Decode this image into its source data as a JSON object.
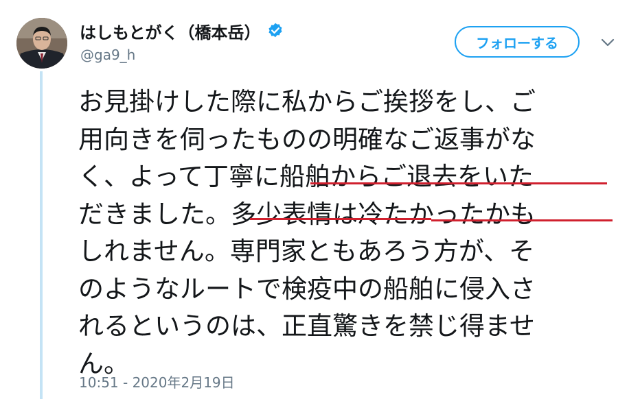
{
  "user": {
    "display_name": "はしもとがく（橋本岳）",
    "handle": "@ga9_h",
    "verified": true,
    "verified_icon": "verified-badge-icon"
  },
  "actions": {
    "follow_label": "フォローする",
    "more_icon": "chevron-down-icon"
  },
  "tweet": {
    "lines": [
      "お見掛けした際に私からご挨拶をし、ご",
      "用向きを伺ったものの明確なご返事がな",
      "く、よって丁寧に船舶からご退去をいた",
      "だきました。多少表情は冷たかったかも",
      "しれません。専門家ともあろう方が、そ",
      "のようなルートで検疫中の船舶に侵入さ",
      "れるというのは、正直驚きを禁じ得ませ",
      "ん。"
    ],
    "timestamp": "10:51 - 2020年2月19日"
  },
  "colors": {
    "accent": "#1da1f2",
    "text": "#14171a",
    "muted": "#657786",
    "annotation_underline": "#d0202e",
    "thread_line": "#c4e3f5"
  }
}
